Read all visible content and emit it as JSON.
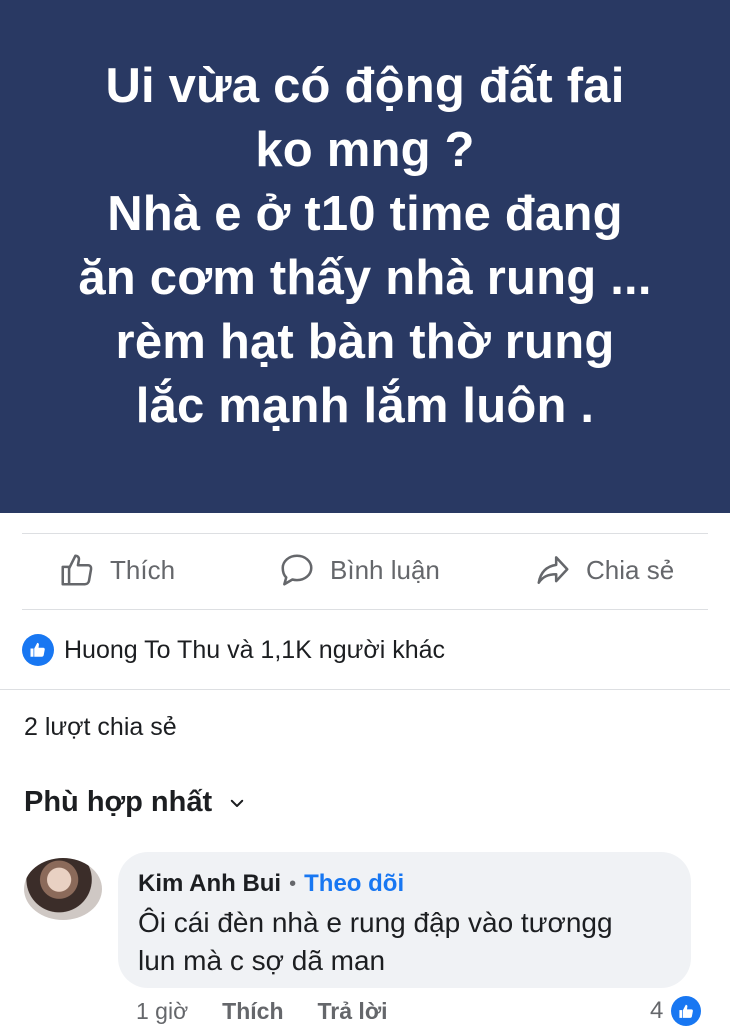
{
  "post": {
    "text_lines": [
      "Ui vừa có động đất fai",
      "ko mng  ?",
      "Nhà e ở t10 time đang",
      "ăn cơm thấy nhà rung ...",
      "rèm hạt bàn thờ rung",
      "lắc mạnh lắm luôn ."
    ],
    "background_color": "#293963"
  },
  "actions": {
    "like_label": "Thích",
    "comment_label": "Bình luận",
    "share_label": "Chia sẻ"
  },
  "reactions": {
    "summary": "Huong To Thu và 1,1K người khác",
    "icon": "like-icon"
  },
  "shares": {
    "text": "2 lượt chia sẻ"
  },
  "sort": {
    "label": "Phù hợp nhất",
    "icon": "chevron-down-icon"
  },
  "comment": {
    "author": "Kim Anh Bui",
    "separator": "•",
    "follow_label": "Theo dõi",
    "text_lines": [
      "Ôi cái đèn nhà e rung đập vào tươngg",
      "lun mà c sợ dã man"
    ],
    "time": "1 giờ",
    "like_label": "Thích",
    "reply_label": "Trả lời",
    "reaction_count": "4"
  },
  "colors": {
    "accent": "#1877f2",
    "muted": "#65676b"
  }
}
